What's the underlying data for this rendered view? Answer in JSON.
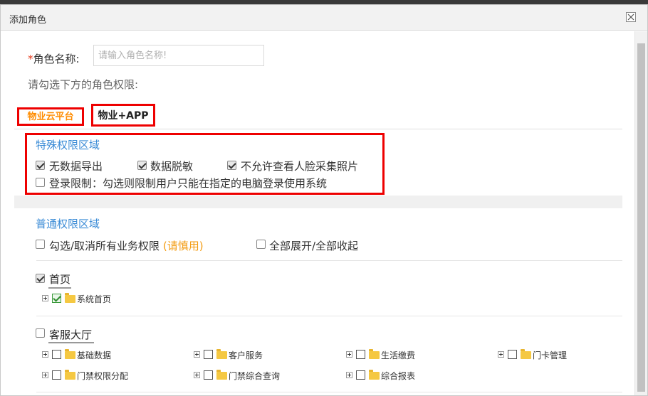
{
  "dialog": {
    "title": "添加角色"
  },
  "form": {
    "required_mark": "*",
    "role_name_label": "角色名称:",
    "role_name_value": "",
    "role_name_placeholder": "请输入角色名称!",
    "hint": "请勾选下方的角色权限:"
  },
  "tabs": [
    {
      "label": "物业云平台",
      "active": true
    },
    {
      "label": "物业+APP",
      "active": false
    }
  ],
  "special": {
    "title": "特殊权限区域",
    "options": [
      {
        "label": "无数据导出",
        "checked": true
      },
      {
        "label": "数据脱敏",
        "checked": true
      },
      {
        "label": "不允许查看人脸采集照片",
        "checked": true
      },
      {
        "label": "登录限制：勾选则限制用户只能在指定的电脑登录使用系统",
        "checked": false
      }
    ]
  },
  "normal": {
    "title": "普通权限区域",
    "select_all_label": "勾选/取消所有业务权限",
    "select_all_warn": "(请慎用)",
    "select_all_checked": false,
    "expand_label": "全部展开/全部收起",
    "expand_checked": false
  },
  "groups": [
    {
      "label": "首页",
      "checked": true,
      "nodes": [
        {
          "label": "系统首页",
          "checked": true
        }
      ]
    },
    {
      "label": "客服大厅",
      "checked": false,
      "nodes": [
        {
          "label": "基础数据",
          "checked": false
        },
        {
          "label": "客户服务",
          "checked": false
        },
        {
          "label": "生活缴费",
          "checked": false
        },
        {
          "label": "门卡管理",
          "checked": false
        },
        {
          "label": "门禁权限分配",
          "checked": false
        },
        {
          "label": "门禁综合查询",
          "checked": false
        },
        {
          "label": "综合报表",
          "checked": false
        }
      ]
    }
  ]
}
